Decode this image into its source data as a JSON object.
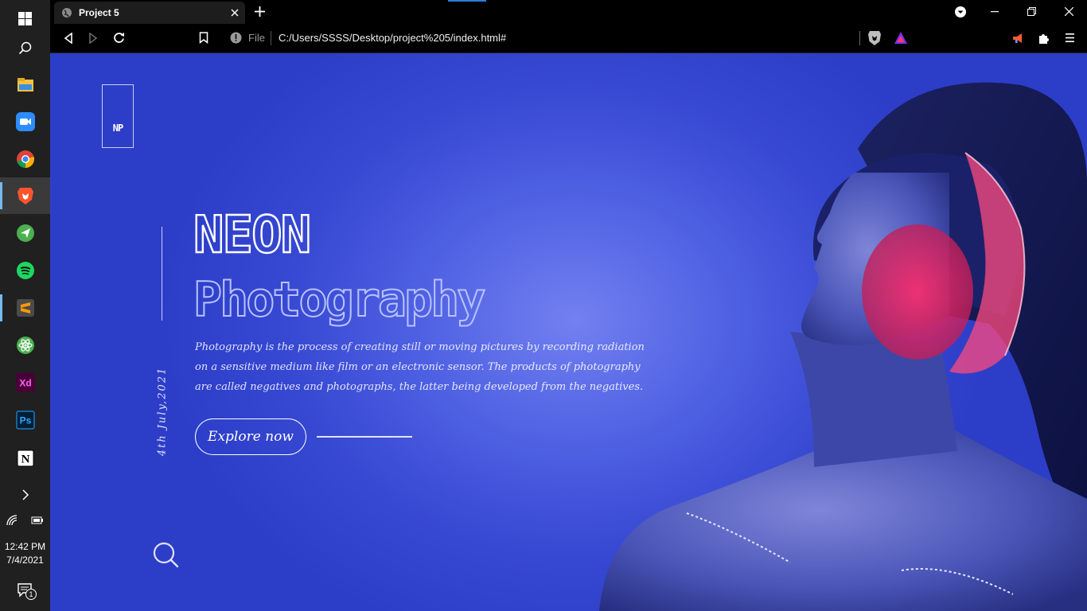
{
  "taskbar": {
    "items": [
      {
        "name": "start-button",
        "icon": "windows-logo-icon"
      },
      {
        "name": "search",
        "icon": "search-icon"
      },
      {
        "name": "file-explorer",
        "icon": "folder-icon"
      },
      {
        "name": "zoom",
        "icon": "video-camera-icon"
      },
      {
        "name": "chrome",
        "icon": "chrome-icon"
      },
      {
        "name": "brave",
        "icon": "brave-lion-icon"
      },
      {
        "name": "telegram",
        "icon": "paper-plane-icon"
      },
      {
        "name": "spotify",
        "icon": "spotify-icon"
      },
      {
        "name": "sublime-text",
        "icon": "sublime-icon",
        "label": "S"
      },
      {
        "name": "atom",
        "icon": "atom-icon"
      },
      {
        "name": "adobe-xd",
        "icon": "xd-icon",
        "label": "Xd"
      },
      {
        "name": "photoshop",
        "icon": "ps-icon",
        "label": "Ps"
      },
      {
        "name": "notion",
        "icon": "notion-icon",
        "label": "N"
      }
    ],
    "time": "12:42 PM",
    "date": "7/4/2021",
    "notification_count": "1"
  },
  "browser": {
    "tab_title": "Project 5",
    "url_scheme_label": "File",
    "url": "C:/Users/SSSS/Desktop/project%205/index.html#"
  },
  "page": {
    "logo": "NP",
    "date_vertical": "4th July,2021",
    "title_line1": "NEON",
    "title_line2": "Photography",
    "description": "Photography is the process of creating still or moving pictures by recording radiation on a sensitive medium like film or an electronic sensor. The products of photography are called negatives and photographs, the latter being developed from the negatives.",
    "cta_label": "Explore now"
  },
  "colors": {
    "page_bg": "#3a4cd6",
    "page_glow": "#7280f0",
    "title_fill": "#ffffff",
    "title_line2_stroke": "#b9c2ff",
    "accent_pink": "#ff3a7a"
  }
}
